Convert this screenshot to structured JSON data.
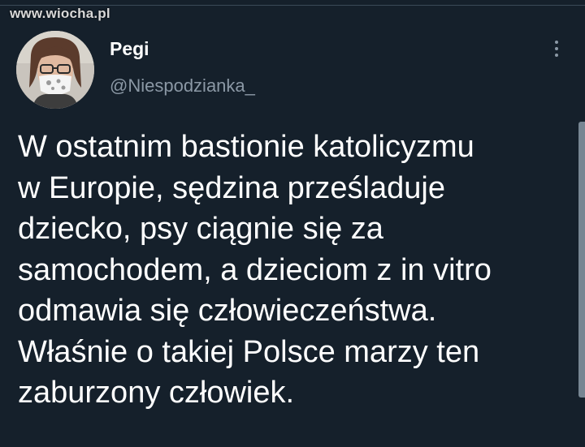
{
  "watermark": "www.wiocha.pl",
  "tweet": {
    "author_name": "Pegi",
    "author_handle": "@Niespodzianka_",
    "more_icon": "vertical-ellipsis-icon",
    "lines": [
      "W ostatnim bastionie katolicyzmu",
      "w Europie, sędzina prześladuje",
      "dziecko, psy ciągnie się za",
      "samochodem, a dzieciom z in vitro",
      "odmawia się człowieczeństwa.",
      "Właśnie o takiej Polsce marzy ten",
      "zaburzony człowiek."
    ]
  },
  "colors": {
    "background": "#15202b",
    "text_primary": "#ffffff",
    "text_secondary": "#8b98a5"
  }
}
